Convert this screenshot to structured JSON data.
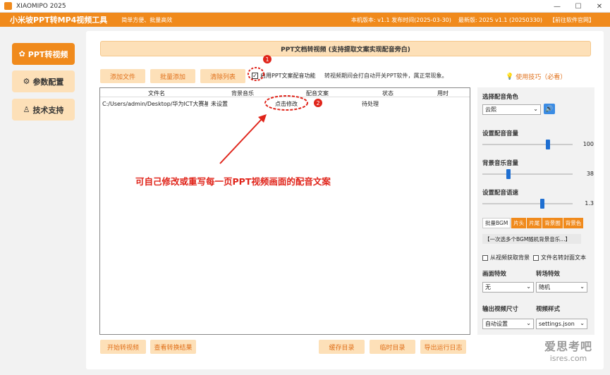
{
  "window": {
    "title": "XIAOMIPO 2025",
    "controls": [
      "—",
      "☐",
      "✕"
    ]
  },
  "header": {
    "brand": "小米坡PPT转MP4视频工具",
    "slogan": "简单方便、批量高效",
    "version": "本机版本:  v1.1  发布时间(2025-03-30)",
    "latest": "最新版:  2025 v1.1 (20250330)",
    "website": "【前往软件官网】"
  },
  "sidebar": {
    "items": [
      {
        "label": "PPT转视频",
        "icon": "palette-icon"
      },
      {
        "label": "参数配置",
        "icon": "gear-icon"
      },
      {
        "label": "技术支持",
        "icon": "person-icon"
      }
    ]
  },
  "banner": {
    "text": "PPT文档转视频 (支持提取文案实现配音旁白)"
  },
  "toolbar": {
    "add_file": "添加文件",
    "batch_add": "批量添加",
    "clear_list": "清除列表",
    "enable_label": "启用PPT文案配音功能",
    "enable_checked": true,
    "note": "转视频期间会打自动开关PPT软件，属正常现象。",
    "tips": "使用技巧（必看）"
  },
  "table": {
    "columns": [
      "文件名",
      "背景音乐",
      "配音文案",
      "状态",
      "用时"
    ],
    "rows": [
      {
        "file": "C:/Users/admin/Desktop/华为ICT大赛基础",
        "music": "未设置",
        "script": "点击修改",
        "status": "待处理",
        "time": ""
      }
    ]
  },
  "annotations": {
    "badge1": "1",
    "badge2": "2",
    "text": "可自己修改或重写每一页PPT视频画面的配音文案"
  },
  "right": {
    "voice_label": "选择配音角色",
    "voice_value": "云熙",
    "voice_volume_label": "设置配音音量",
    "voice_volume": 100,
    "bg_volume_label": "背景音乐音量",
    "bg_volume": 38,
    "speed_label": "设置配音语速",
    "speed": 1.3,
    "bgm_tabs": [
      "批量BGM",
      "片头",
      "片尾",
      "背景图",
      "背景色"
    ],
    "bgm_random": "【一次选多个BGM随机背景音乐...】",
    "cb_video_bg": "从视频获取背景",
    "cb_filename_cover": "文件名转封面文本",
    "effect_label": "画面特效",
    "effect_value": "无",
    "transition_label": "转场特效",
    "transition_value": "随机",
    "size_label": "输出视频尺寸",
    "size_value": "自动设置",
    "style_label": "视频样式",
    "style_value": "settings.json"
  },
  "bottom": {
    "start": "开始转视频",
    "view_result": "查看转换结果",
    "cache_dir": "缓存目录",
    "temp_dir": "临时目录",
    "export_log": "导出运行日志"
  },
  "watermark": {
    "line1": "爱思考吧",
    "line2": "isres.com"
  },
  "colors": {
    "accent": "#f08a1c",
    "light": "#fde0b8",
    "annotation": "#e0251b",
    "slider": "#1f6fd1"
  }
}
